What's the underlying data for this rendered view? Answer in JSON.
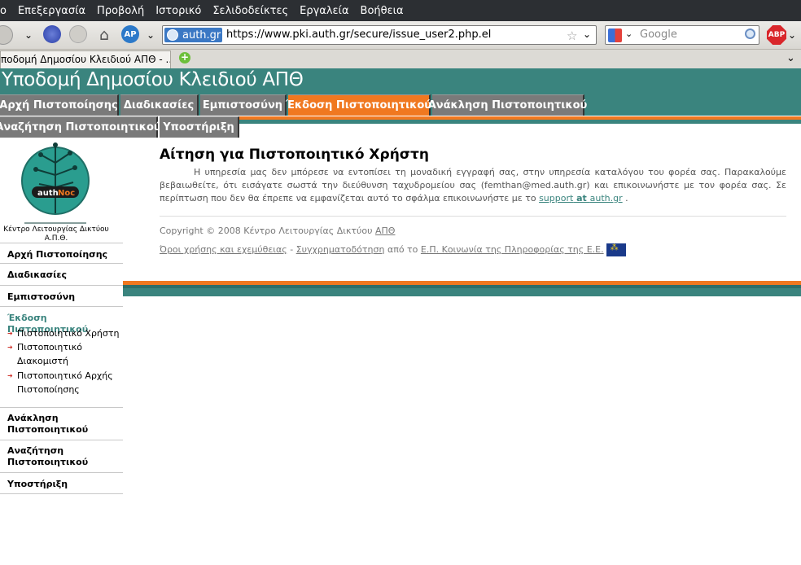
{
  "browser": {
    "menu": [
      "ο",
      "Επεξεργασία",
      "Προβολή",
      "Ιστορικό",
      "Σελιδοδείκτες",
      "Εργαλεία",
      "Βοήθεια"
    ],
    "site_badge": "auth.gr",
    "url": "https://www.pki.auth.gr/secure/issue_user2.php.el",
    "search_placeholder": "Google",
    "abp_label": "ABP",
    "tab_title": "ποδομή Δημοσίου Κλειδιού ΑΠΘ - ..."
  },
  "site": {
    "title": "Υποδομή Δημοσίου Κλειδιού ΑΠΘ",
    "nav_row1": [
      "Αρχή Πιστοποίησης",
      "Διαδικασίες",
      "Εμπιστοσύνη",
      "Έκδοση Πιστοποιητικού",
      "Ανάκληση Πιστοποιητικού"
    ],
    "nav_row2": [
      "Αναζήτηση Πιστοποιητικού",
      "Υποστήριξη"
    ],
    "active_nav": "Έκδοση Πιστοποιητικού"
  },
  "sidebar": {
    "logo_text": "auth",
    "logo_text2": "Noc",
    "logo_caption": "Κέντρο Λειτουργίας Δικτύου Α.Π.Θ.",
    "items": [
      {
        "label": "Αρχή Πιστοποίησης"
      },
      {
        "label": "Διαδικασίες"
      },
      {
        "label": "Εμπιστοσύνη"
      },
      {
        "label": "Έκδοση Πιστοποιητικού"
      },
      {
        "label": "Ανάκληση Πιστοποιητικού"
      },
      {
        "label": "Αναζήτηση Πιστοποιητικού"
      },
      {
        "label": "Υποστήριξη"
      }
    ],
    "subitems": [
      "Πιστοποιητικό Χρήστη",
      "Πιστοποιητικό Διακομιστή",
      "Πιστοποιητικό Αρχής Πιστοποίησης"
    ]
  },
  "main": {
    "heading": "Αίτηση για Πιστοποιητικό Χρήστη",
    "message": "Η υπηρεσία μας δεν μπόρεσε να εντοπίσει τη μοναδική εγγραφή σας, στην υπηρεσία καταλόγου του φορέα σας. Παρακαλούμε βεβαιωθείτε, ότι εισάγατε σωστά την διεύθυνση ταχυδρομείου σας (femthan@med.auth.gr) και επικοινωνήστε με τον φορέα σας. Σε περίπτωση που δεν θα έπρεπε να εμφανίζεται αυτό το σφάλμα επικοινωνήστε με το",
    "support_link_pre": "support",
    "support_link_at": " at ",
    "support_link_post": "auth.gr",
    "message_end": " .",
    "copyright": "Copyright © 2008 Κέντρο Λειτουργίας Δικτύου ",
    "copyright_link": "ΑΠΘ",
    "terms_link": "Όροι χρήσης και εχεμύθειας",
    "sep": " - ",
    "funding_link": "Συγχρηματοδότηση",
    "funding_mid": " από το ",
    "program_link": "Ε.Π. Κοινωνία της Πληροφορίας της Ε.Ε."
  },
  "colors": {
    "teal": "#3a847e",
    "orange": "#f07820",
    "tab_gray": "#7a7a7a"
  }
}
